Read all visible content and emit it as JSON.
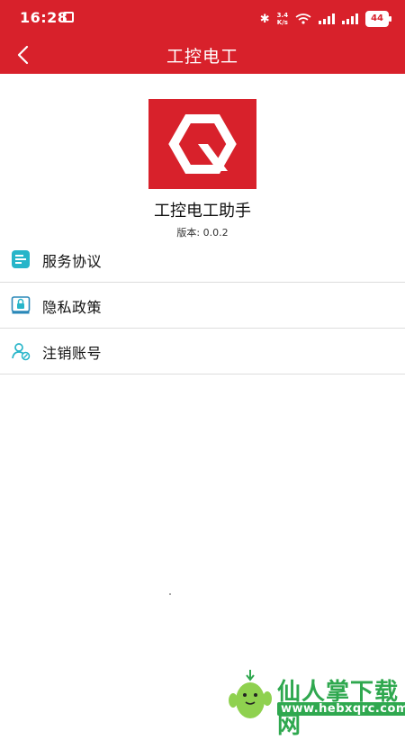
{
  "status_bar": {
    "time": "16:28",
    "net_speed_value": "3.4",
    "net_speed_unit": "K/s",
    "battery_level": "44"
  },
  "navbar": {
    "title": "工控电工"
  },
  "app": {
    "name": "工控电工助手",
    "version_label": "版本:",
    "version": "0.0.2"
  },
  "menu": {
    "items": [
      {
        "label": "服务协议",
        "icon": "document-list-icon"
      },
      {
        "label": "隐私政策",
        "icon": "privacy-lock-icon"
      },
      {
        "label": "注销账号",
        "icon": "user-cancel-icon"
      }
    ]
  },
  "watermark": {
    "text": "仙人掌下载网",
    "url": "www.hebxqrc.com"
  },
  "colors": {
    "brand_red": "#d8212b",
    "icon_teal": "#27b5c9",
    "watermark_green": "#2fa84f"
  }
}
